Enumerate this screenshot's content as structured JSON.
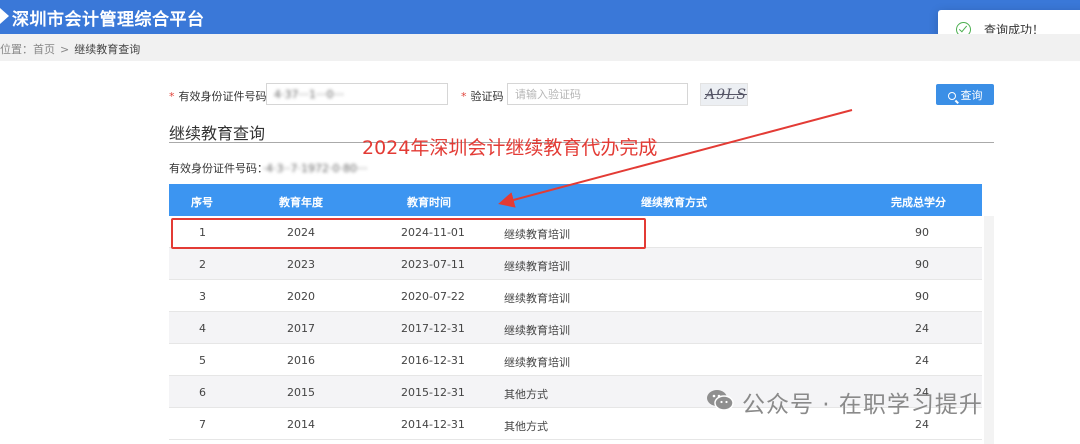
{
  "app": {
    "title": "深圳市会计管理综合平台"
  },
  "breadcrumb": {
    "prefix": "位置：",
    "home": "首页",
    "separator": ">",
    "current": "继续教育查询"
  },
  "toast": {
    "text": "查询成功！"
  },
  "form": {
    "id_label": "有效身份证件号码",
    "id_value": "4·37···1···0···",
    "captcha_label": "验证码",
    "captcha_placeholder": "请输入验证码",
    "captcha_image_text": "A9LS",
    "query_button": "查询"
  },
  "section": {
    "title": "继续教育查询"
  },
  "result": {
    "id_label": "有效身份证件号码：",
    "id_value": "·4·3··7·1972·0·80···"
  },
  "table": {
    "headers": [
      "序号",
      "教育年度",
      "教育时间",
      "继续教育方式",
      "完成总学分"
    ],
    "rows": [
      {
        "no": "1",
        "year": "2024",
        "date": "2024-11-01",
        "method": "继续教育培训",
        "credits": "90"
      },
      {
        "no": "2",
        "year": "2023",
        "date": "2023-07-11",
        "method": "继续教育培训",
        "credits": "90"
      },
      {
        "no": "3",
        "year": "2020",
        "date": "2020-07-22",
        "method": "继续教育培训",
        "credits": "90"
      },
      {
        "no": "4",
        "year": "2017",
        "date": "2017-12-31",
        "method": "继续教育培训",
        "credits": "24"
      },
      {
        "no": "5",
        "year": "2016",
        "date": "2016-12-31",
        "method": "继续教育培训",
        "credits": "24"
      },
      {
        "no": "6",
        "year": "2015",
        "date": "2015-12-31",
        "method": "其他方式",
        "credits": "24"
      },
      {
        "no": "7",
        "year": "2014",
        "date": "2014-12-31",
        "method": "其他方式",
        "credits": "24"
      }
    ]
  },
  "annotation": {
    "text": "2024年深圳会计继续教育代办完成",
    "color": "#e33b35"
  },
  "watermark": {
    "text": "公众号 · 在职学习提升"
  },
  "colors": {
    "header_blue": "#3a78d8",
    "table_header": "#3c95f1",
    "button": "#3b8fe6",
    "success": "#4caf50"
  }
}
